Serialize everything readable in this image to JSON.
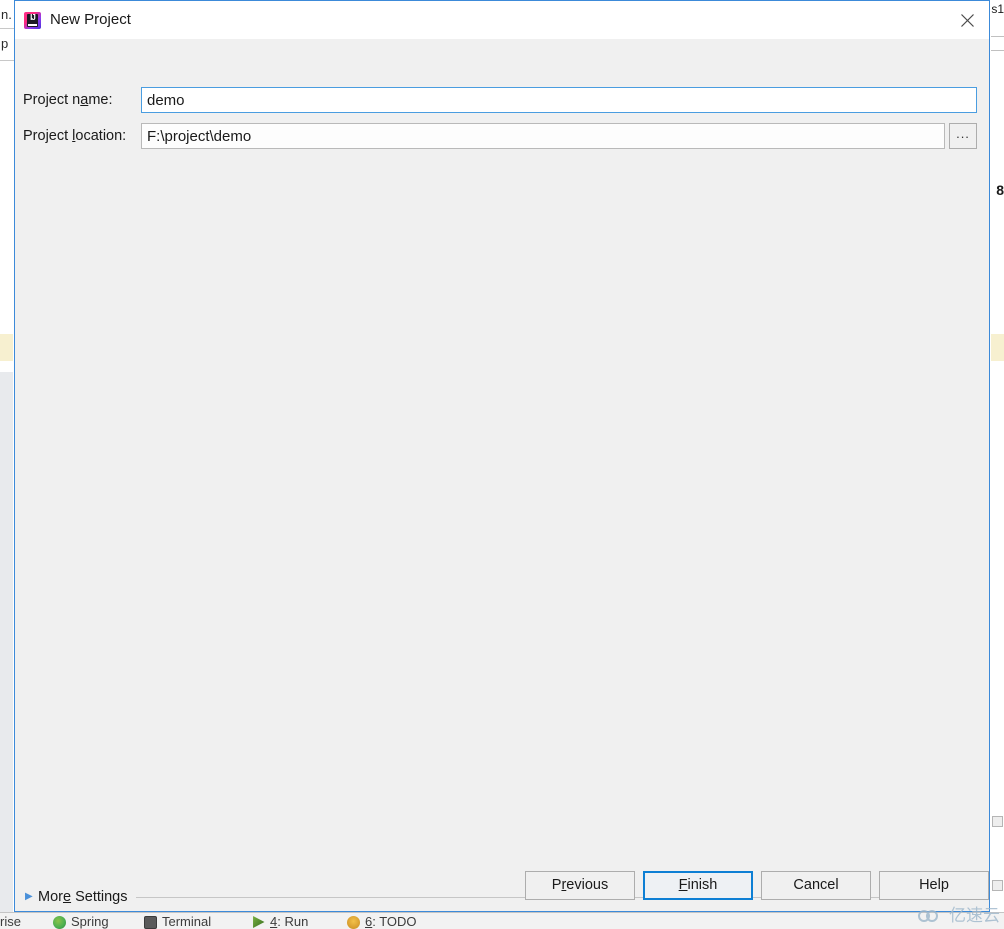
{
  "dialog": {
    "title": "New Project",
    "app_icon": "intellij-idea-icon",
    "close_icon": "close-icon",
    "fields": {
      "project_name": {
        "label_pre": "Project n",
        "label_mnemonic": "a",
        "label_post": "me:",
        "value": "demo",
        "placeholder": ""
      },
      "project_location": {
        "label_pre": "Project ",
        "label_mnemonic": "l",
        "label_post": "ocation:",
        "value": "F:\\project\\demo",
        "placeholder": "",
        "browse_label": "..."
      }
    },
    "more_settings": {
      "arrow": "▶",
      "label_pre": "Mor",
      "label_mnemonic": "e",
      "label_post": " Settings",
      "expanded": false
    },
    "buttons": {
      "previous": {
        "pre": "P",
        "mnemonic": "r",
        "post": "evious",
        "default": false
      },
      "finish": {
        "pre": "",
        "mnemonic": "F",
        "post": "inish",
        "default": true
      },
      "cancel": {
        "pre": "Cancel",
        "mnemonic": "",
        "post": "",
        "default": false
      },
      "help": {
        "pre": "Help",
        "mnemonic": "",
        "post": "",
        "default": false
      }
    }
  },
  "backdrop": {
    "left_text_top": "n.",
    "left_text_second": "p",
    "right_text_top": "s1",
    "right_text_mid": "8",
    "statusbar": [
      {
        "name": "enterprise",
        "label": "rise",
        "icon": ""
      },
      {
        "name": "spring",
        "label": "Spring",
        "icon": "spring-icon"
      },
      {
        "name": "terminal",
        "label": "Terminal",
        "icon": "terminal-icon"
      },
      {
        "name": "run",
        "label_pre": "",
        "mnemonic": "4",
        "label_post": ": Run",
        "icon": "run-icon"
      },
      {
        "name": "todo",
        "label_pre": "",
        "mnemonic": "6",
        "label_post": ": TODO",
        "icon": "todo-icon"
      }
    ]
  },
  "watermark": {
    "text": "亿速云",
    "logo": "cloud-rings-icon"
  },
  "colors": {
    "accent_blue": "#0d7fd4",
    "dialog_bg": "#f0f0f0",
    "titlebar_bg": "#ffffff",
    "field_focus_border": "#4a9de0",
    "watermark": "#9fb8cc"
  }
}
